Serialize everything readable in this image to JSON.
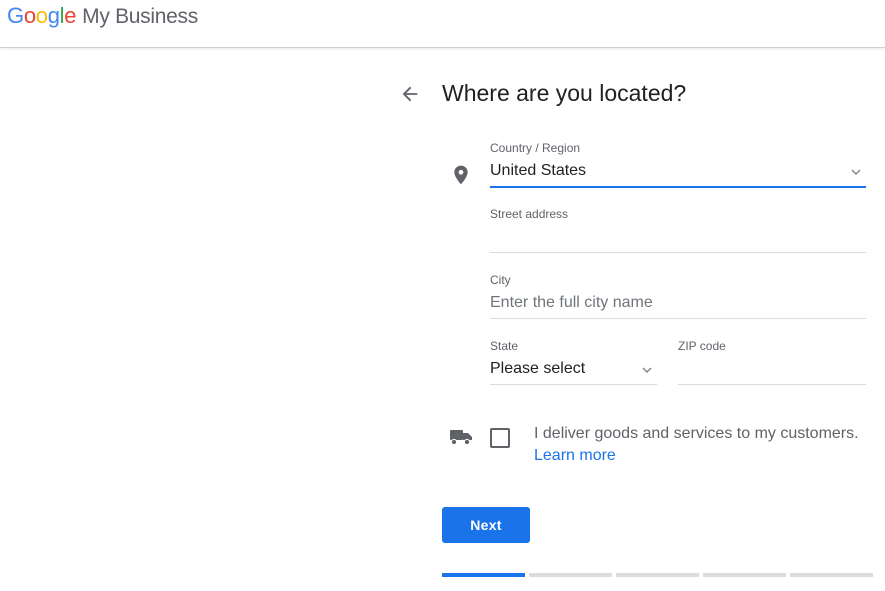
{
  "header": {
    "logo_letters": [
      "G",
      "o",
      "o",
      "g",
      "l",
      "e"
    ],
    "product_name": "My Business"
  },
  "page": {
    "title": "Where are you located?",
    "back_icon": "arrow-left-icon"
  },
  "form": {
    "country": {
      "label": "Country / Region",
      "value": "United States",
      "icon": "location-pin-icon"
    },
    "street": {
      "label": "Street address",
      "value": ""
    },
    "city": {
      "label": "City",
      "placeholder": "Enter the full city name"
    },
    "state": {
      "label": "State",
      "value": "Please select"
    },
    "zip": {
      "label": "ZIP code",
      "value": ""
    }
  },
  "delivery": {
    "icon": "truck-icon",
    "checked": false,
    "label": "I deliver goods and services to my customers.",
    "link": "Learn more"
  },
  "actions": {
    "next_label": "Next"
  },
  "progress": {
    "current_step": 1,
    "total_steps": 5
  },
  "colors": {
    "accent": "#1a73e8",
    "text_primary": "#202124",
    "text_secondary": "#5f6368",
    "divider": "#dadce0"
  }
}
